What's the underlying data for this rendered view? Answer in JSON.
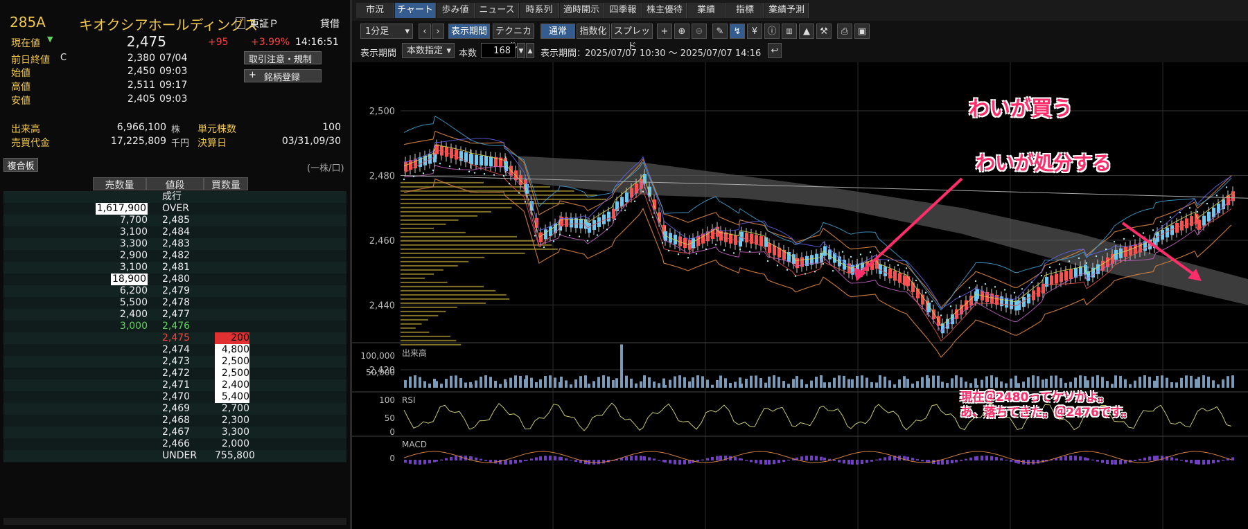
{
  "left": {
    "code": "285A",
    "company": "キオクシアホールディングス",
    "exchange": "東証Ｐ",
    "kashi": "貸借",
    "current_label": "現在値",
    "current_price": "2,475",
    "change": "+95",
    "change_pct": "+3.99%",
    "time": "14:16:51",
    "prev_close_label": "前日終値",
    "prev_close_flag": "C",
    "prev_close": "2,380",
    "prev_close_date": "07/04",
    "open_label": "始値",
    "open": "2,450",
    "open_time": "09:03",
    "high_label": "高値",
    "high": "2,511",
    "high_time": "09:17",
    "low_label": "安値",
    "low": "2,405",
    "low_time": "09:03",
    "btn_rules": "取引注意・規制",
    "btn_register": "銘柄登録",
    "volume_label": "出来高",
    "volume": "6,966,100",
    "volume_unit": "株",
    "unit_label": "単元株数",
    "unit": "100",
    "turnover_label": "売買代金",
    "turnover": "17,225,809",
    "turnover_unit": "千円",
    "settle_label": "決算日",
    "settle": "03/31,09/30",
    "board_button": "複合板",
    "per_share": "(一株/口)",
    "col_sell": "売数量",
    "col_price": "値段",
    "col_buy": "買数量",
    "rows": [
      {
        "sell": "",
        "price": "成行",
        "buy": ""
      },
      {
        "sell": "1,617,900",
        "price": "OVER",
        "buy": "",
        "sellhl": true
      },
      {
        "sell": "7,700",
        "price": "2,485",
        "buy": ""
      },
      {
        "sell": "3,100",
        "price": "2,484",
        "buy": ""
      },
      {
        "sell": "3,300",
        "price": "2,483",
        "buy": ""
      },
      {
        "sell": "2,900",
        "price": "2,482",
        "buy": ""
      },
      {
        "sell": "3,100",
        "price": "2,481",
        "buy": ""
      },
      {
        "sell": "18,900",
        "price": "2,480",
        "buy": "",
        "sellhl": true
      },
      {
        "sell": "6,200",
        "price": "2,479",
        "buy": ""
      },
      {
        "sell": "5,500",
        "price": "2,478",
        "buy": ""
      },
      {
        "sell": "2,400",
        "price": "2,477",
        "buy": ""
      },
      {
        "sell": "3,000",
        "price": "2,476",
        "buy": "",
        "green": true
      },
      {
        "sell": "",
        "price": "2,475",
        "buy": "200",
        "red": true
      },
      {
        "sell": "",
        "price": "2,474",
        "buy": "4,800",
        "buyhl": true
      },
      {
        "sell": "",
        "price": "2,473",
        "buy": "2,500",
        "buyhl": true
      },
      {
        "sell": "",
        "price": "2,472",
        "buy": "2,500",
        "buyhl": true
      },
      {
        "sell": "",
        "price": "2,471",
        "buy": "2,400",
        "buyhl": true
      },
      {
        "sell": "",
        "price": "2,470",
        "buy": "5,400",
        "buyhl": true
      },
      {
        "sell": "",
        "price": "2,469",
        "buy": "2,700"
      },
      {
        "sell": "",
        "price": "2,468",
        "buy": "2,300"
      },
      {
        "sell": "",
        "price": "2,467",
        "buy": "3,300"
      },
      {
        "sell": "",
        "price": "2,466",
        "buy": "2,000"
      },
      {
        "sell": "",
        "price": "UNDER",
        "buy": "755,800"
      }
    ]
  },
  "tabs": [
    "市況",
    "チャート",
    "歩み値",
    "ニュース",
    "時系列",
    "適時開示",
    "四季報",
    "株主優待",
    "業績",
    "指標",
    "業績予測"
  ],
  "toolbar": {
    "interval": "1分足",
    "display_period": "表示期間",
    "technical": "テクニカル",
    "normal": "通常",
    "index": "指数化",
    "spread": "スプレッド",
    "period_label": "表示期間",
    "period_mode": "本数指定",
    "count_label": "本数",
    "count": "168",
    "range_label": "表示期間：",
    "range": "2025/07/07 10:30 〜 2025/07/07 14:16"
  },
  "chart": {
    "y_ticks": [
      "2,500",
      "2,480",
      "2,460",
      "2,440",
      "2,420"
    ],
    "volume_label": "出来高",
    "volume_ticks": [
      "100,000",
      "50,000"
    ],
    "rsi_label": "RSI",
    "rsi_ticks": [
      "100",
      "50",
      "0"
    ],
    "macd_label": "MACD",
    "macd_ticks": [
      "0"
    ]
  },
  "annotations": {
    "buy": "わいが買う",
    "sell": "わいが処分する",
    "note1": "現在＠2480ってケソかよ。",
    "note2": "あ、落ちてきた。＠2476です。"
  },
  "colors": {
    "accent": "#f2c94c",
    "up": "#ff3b3b",
    "down": "#5fd35f",
    "annotation": "#ff2d6a"
  }
}
